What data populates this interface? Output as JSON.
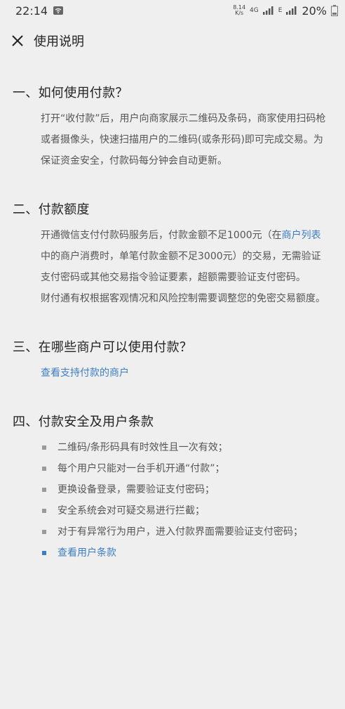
{
  "status_bar": {
    "time": "22:14",
    "net_speed_value": "8.14",
    "net_speed_unit": "K/s",
    "net_type_a": "4G",
    "net_type_b": "E",
    "battery": "20%"
  },
  "header": {
    "title": "使用说明"
  },
  "sections": [
    {
      "heading": "一、如何使用付款？",
      "paragraph": "打开“收付款”后，用户向商家展示二维码及条码，商家使用扫码枪或者摄像头，快速扫描用户的二维码(或条形码)即可完成交易。为保证资金安全，付款码每分钟会自动更新。"
    },
    {
      "heading": "二、付款额度",
      "paragraph_before_link": "开通微信支付付款码服务后，付款金额不足1000元（在",
      "link": "商户列表",
      "paragraph_after_link": "中的商户消费时，单笔付款金额不足3000元）的交易，无需验证支付密码或其他交易指令验证要素，超额需要验证支付密码。",
      "paragraph2": "财付通有权根据客观情况和风险控制需要调整您的免密交易额度。"
    },
    {
      "heading": "三、在哪些商户可以使用付款？",
      "link": "查看支持付款的商户"
    },
    {
      "heading": "四、付款安全及用户条款",
      "bullets": [
        "二维码/条形码具有时效性且一次有效；",
        "每个用户只能对一台手机开通“付款”；",
        "更换设备登录，需要验证支付密码；",
        "安全系统会对可疑交易进行拦截；",
        "对于有异常行为用户，进入付款界面需要验证支付密码；"
      ],
      "link": "查看用户条款"
    }
  ],
  "colors": {
    "background": "#efefef",
    "link": "#3e7dc6",
    "body_text": "#555555",
    "heading_text": "#222222"
  }
}
